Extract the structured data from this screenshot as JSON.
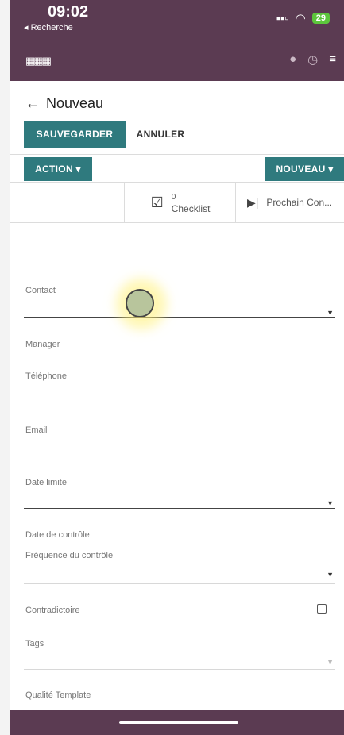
{
  "status": {
    "time": "09:02",
    "back_app": "◂ Recherche",
    "battery": "29"
  },
  "breadcrumb": {
    "title": "Nouveau"
  },
  "toolbar": {
    "save": "SAUVEGARDER",
    "cancel": "ANNULER",
    "action": "ACTION ▾",
    "new": "NOUVEAU ▾"
  },
  "smart_buttons": {
    "checklist_count": "0",
    "checklist_label": "Checklist",
    "next_label": "Prochain Con..."
  },
  "fields": {
    "contact": "Contact",
    "manager": "Manager",
    "phone": "Téléphone",
    "email": "Email",
    "deadline": "Date limite",
    "control_date": "Date de contrôle",
    "frequency": "Fréquence du contrôle",
    "contradictory": "Contradictoire",
    "tags": "Tags",
    "template": "Qualité Template"
  }
}
